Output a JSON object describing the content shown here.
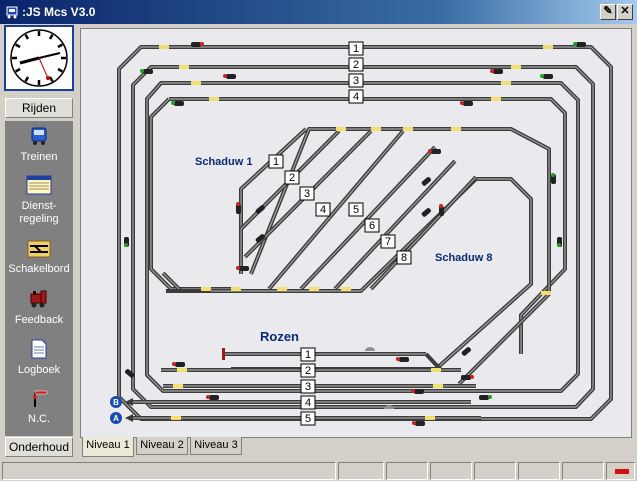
{
  "window": {
    "title": ":JS Mcs V3.0"
  },
  "clock": {
    "name": "clock"
  },
  "sidebar": {
    "rijden_label": "Rijden",
    "items": [
      {
        "label": "Treinen"
      },
      {
        "label": "Dienst-\nregeling"
      },
      {
        "label": "Schakelbord"
      },
      {
        "label": "Feedback"
      },
      {
        "label": "Logboek"
      },
      {
        "label": "N.C."
      }
    ],
    "onderhoud_label": "Onderhoud"
  },
  "layout": {
    "schaduw1_label": "Schaduw 1",
    "schaduw8_label": "Schaduw 8",
    "rozen_label": "Rozen",
    "top_tracks": [
      "1",
      "2",
      "3",
      "4"
    ],
    "schaduw_tracks": [
      "1",
      "2",
      "3",
      "4",
      "5",
      "6",
      "7",
      "8"
    ],
    "rozen_tracks": [
      "1",
      "2",
      "3",
      "4",
      "5"
    ],
    "endpoint_b": "B",
    "endpoint_a": "A"
  },
  "tabs": [
    {
      "label": "Niveau 1",
      "active": true
    },
    {
      "label": "Niveau 2",
      "active": false
    },
    {
      "label": "Niveau 3",
      "active": false
    }
  ],
  "colors": {
    "track": "#3c3c3c",
    "track_inner": "#9a9a9a",
    "label_blue": "#0a2a7a",
    "accent_titlebar": "#0a246a"
  }
}
